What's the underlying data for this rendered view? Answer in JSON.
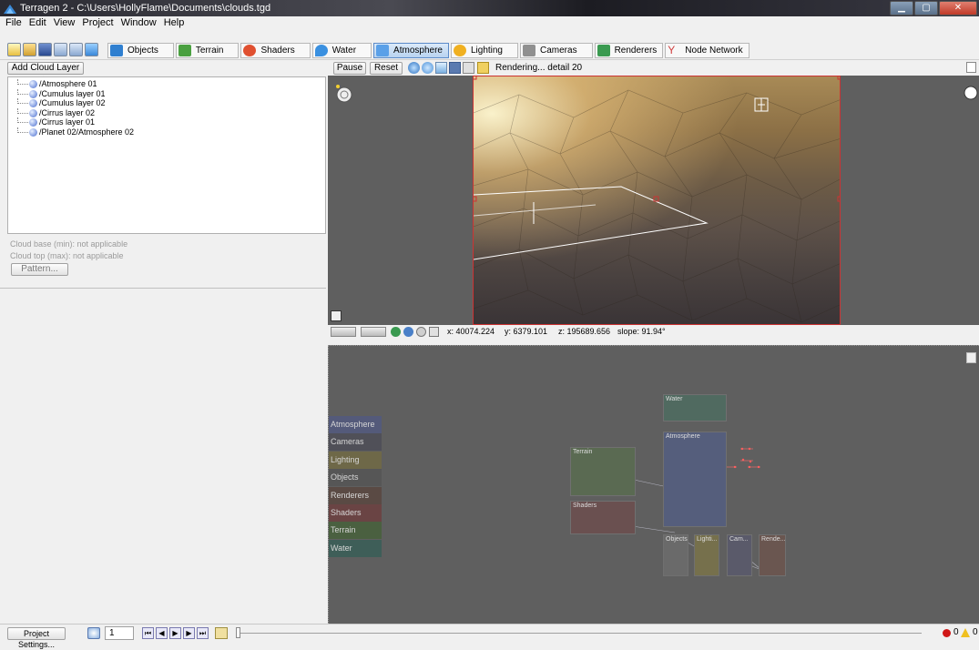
{
  "window": {
    "title": "Terragen 2 - C:\\Users\\HollyFlame\\Documents\\clouds.tgd"
  },
  "menu": [
    "File",
    "Edit",
    "View",
    "Project",
    "Window",
    "Help"
  ],
  "toolbar": {
    "tabs": [
      {
        "label": "Objects",
        "icon": "objects-icon",
        "color": "#2f7fd0"
      },
      {
        "label": "Terrain",
        "icon": "terrain-icon",
        "color": "#4aa040"
      },
      {
        "label": "Shaders",
        "icon": "shaders-icon",
        "color": "#e05030"
      },
      {
        "label": "Water",
        "icon": "water-icon",
        "color": "#3a90e0"
      },
      {
        "label": "Atmosphere",
        "icon": "atmosphere-icon",
        "color": "#5aa0e8"
      },
      {
        "label": "Lighting",
        "icon": "lighting-icon",
        "color": "#f0b020"
      },
      {
        "label": "Cameras",
        "icon": "cameras-icon",
        "color": "#707070"
      },
      {
        "label": "Renderers",
        "icon": "renderers-icon",
        "color": "#3a9a50"
      },
      {
        "label": "Node Network",
        "icon": "node-network-icon",
        "color": "#d04040"
      }
    ],
    "active_tab": "Atmosphere"
  },
  "left": {
    "add_button": "Add Cloud Layer",
    "tree": [
      "/Atmosphere 01",
      "/Cumulus layer 01",
      "/Cumulus layer 02",
      "/Cirrus layer 02",
      "/Cirrus layer 01",
      "/Planet 02/Atmosphere 02"
    ],
    "props": {
      "cloud_base": "Cloud base (min): not applicable",
      "cloud_top": "Cloud top (max): not applicable",
      "pattern_button": "Pattern..."
    }
  },
  "viewport": {
    "pause_label": "Pause",
    "reset_label": "Reset",
    "status": "Rendering... detail 20"
  },
  "coords": {
    "x": "x: 40074.224",
    "y": "y: 6379.101",
    "z": "z: 195689.656",
    "slope": "slope: 91.94°"
  },
  "node_categories": [
    {
      "label": "Atmosphere",
      "color": "#545a7a"
    },
    {
      "label": "Cameras",
      "color": "#505058"
    },
    {
      "label": "Lighting",
      "color": "#6e6848"
    },
    {
      "label": "Objects",
      "color": "#565656"
    },
    {
      "label": "Renderers",
      "color": "#5a4a44"
    },
    {
      "label": "Shaders",
      "color": "#6a4444"
    },
    {
      "label": "Terrain",
      "color": "#4a6040"
    },
    {
      "label": "Water",
      "color": "#3e5e58"
    }
  ],
  "nodes": {
    "water": "Water",
    "atmosphere": "Atmosphere",
    "terrain": "Terrain",
    "shaders": "Shaders",
    "objects": "Objects",
    "lighting": "Lighti...",
    "cameras": "Cam...",
    "renderers": "Rende..."
  },
  "statusbar": {
    "project_settings": "Project Settings...",
    "frame": "1",
    "errors": "0",
    "warnings": "0"
  }
}
